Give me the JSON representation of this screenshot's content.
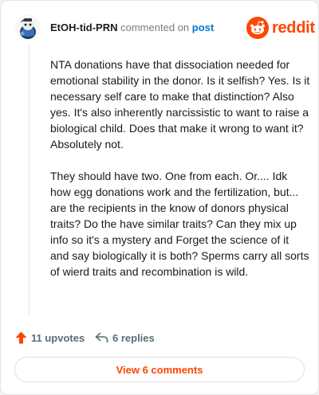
{
  "comment": {
    "username": "EtOH-tid-PRN",
    "action_text": "commented on",
    "post_link": "post",
    "paragraphs": [
      "NTA donations have that dissociation needed for emotional stability in the donor. Is it selfish? Yes. Is it necessary self care to make that distinction? Also yes. It's also inherently narcissistic to want to raise a biological child. Does that make it wrong to want it? Absolutely not.",
      "They should have two. One from each. Or.... Idk how egg donations work and the fertilization, but... are the recipients in the know of donors physical traits? Do the have similar traits? Can they mix up info so it's a mystery and Forget the science of it and say biologically it is both? Sperms carry all sorts of wierd traits and recombination is wild."
    ]
  },
  "brand": {
    "name": "reddit",
    "logo_icon": "reddit-snoo-icon",
    "color": "#ff4500"
  },
  "actions": {
    "upvotes": "11 upvotes",
    "upvote_icon": "upvote-arrow-icon",
    "replies": "6 replies",
    "reply_icon": "reply-arrow-icon"
  },
  "footer": {
    "view_comments": "View 6 comments"
  },
  "colors": {
    "accent": "#ff4500",
    "link": "#0079d3",
    "muted": "#576f76"
  }
}
